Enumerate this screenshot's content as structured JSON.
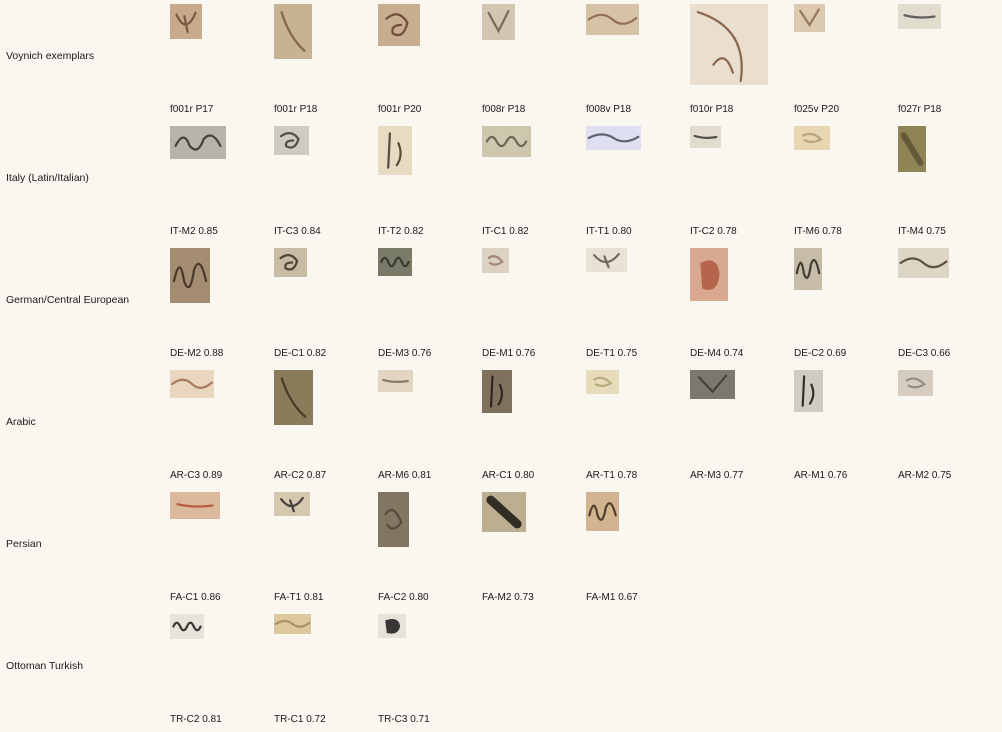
{
  "rows": [
    {
      "label": "Voynich exemplars",
      "items": [
        {
          "caption": "f001r P17",
          "bg": "#c9a98c",
          "ink": "#6b4a34",
          "glyph": "hook"
        },
        {
          "caption": "f001r P18",
          "bg": "#c7b294",
          "ink": "#7a5a3c",
          "glyph": "slash"
        },
        {
          "caption": "f001r P20",
          "bg": "#c8ad90",
          "ink": "#5e3f2a",
          "glyph": "loop"
        },
        {
          "caption": "f008r P18",
          "bg": "#d2c6b0",
          "ink": "#6a5a48",
          "glyph": "vee"
        },
        {
          "caption": "f008v P18",
          "bg": "#d6c2a6",
          "ink": "#8a6448",
          "glyph": "wave"
        },
        {
          "caption": "f010r P18",
          "bg": "#eadfcf",
          "ink": "#7a5436",
          "glyph": "arc"
        },
        {
          "caption": "f025v P20",
          "bg": "#dccab0",
          "ink": "#8a6a4c",
          "glyph": "vee"
        },
        {
          "caption": "f027r P18",
          "bg": "#e2dccf",
          "ink": "#4a4a4a",
          "glyph": "dash"
        }
      ]
    },
    {
      "label": "Italy (Latin/Italian)",
      "items": [
        {
          "caption": "IT-M2 0.85",
          "bg": "#b6b4a8",
          "ink": "#2c2c2c",
          "glyph": "script"
        },
        {
          "caption": "IT-C3 0.84",
          "bg": "#cfcbc2",
          "ink": "#3c3a36",
          "glyph": "loop"
        },
        {
          "caption": "IT-T2 0.82",
          "bg": "#e7dcc2",
          "ink": "#3a3224",
          "glyph": "tall"
        },
        {
          "caption": "IT-C1 0.82",
          "bg": "#cfc6ae",
          "ink": "#5a5644",
          "glyph": "curls"
        },
        {
          "caption": "IT-T1 0.80",
          "bg": "#dedff0",
          "ink": "#4a4e5a",
          "glyph": "wave"
        },
        {
          "caption": "IT-C2 0.78",
          "bg": "#e2dccf",
          "ink": "#3a3632",
          "glyph": "dash"
        },
        {
          "caption": "IT-M6 0.78",
          "bg": "#e6d6b2",
          "ink": "#b09a72",
          "glyph": "smudge"
        },
        {
          "caption": "IT-M4 0.75",
          "bg": "#8e8456",
          "ink": "#5a5434",
          "glyph": "bar"
        }
      ]
    },
    {
      "label": "German/Central European",
      "items": [
        {
          "caption": "DE-M2 0.88",
          "bg": "#a48c72",
          "ink": "#3a2a1e",
          "glyph": "script"
        },
        {
          "caption": "DE-C1 0.82",
          "bg": "#c8bca4",
          "ink": "#3a3024",
          "glyph": "loop"
        },
        {
          "caption": "DE-M3 0.76",
          "bg": "#7a7a68",
          "ink": "#2c2c24",
          "glyph": "curls"
        },
        {
          "caption": "DE-M1 0.76",
          "bg": "#dcd2c4",
          "ink": "#9a7a6a",
          "glyph": "smudge"
        },
        {
          "caption": "DE-T1 0.75",
          "bg": "#e8e2d4",
          "ink": "#5a5448",
          "glyph": "hook"
        },
        {
          "caption": "DE-M4 0.74",
          "bg": "#d8a890",
          "ink": "#b05a40",
          "glyph": "blob"
        },
        {
          "caption": "DE-C2 0.69",
          "bg": "#c6bca8",
          "ink": "#2a2620",
          "glyph": "script"
        },
        {
          "caption": "DE-C3 0.66",
          "bg": "#ddd6c6",
          "ink": "#4a3a2a",
          "glyph": "wave"
        }
      ]
    },
    {
      "label": "Arabic",
      "items": [
        {
          "caption": "AR-C3 0.89",
          "bg": "#ead6be",
          "ink": "#9a6a4a",
          "glyph": "wave"
        },
        {
          "caption": "AR-C2 0.87",
          "bg": "#8a7c5a",
          "ink": "#3a3020",
          "glyph": "slash"
        },
        {
          "caption": "AR-M6 0.81",
          "bg": "#e2d6c2",
          "ink": "#7a6a5a",
          "glyph": "dash"
        },
        {
          "caption": "AR-C1 0.80",
          "bg": "#7e725c",
          "ink": "#1e1a14",
          "glyph": "tall"
        },
        {
          "caption": "AR-T1 0.78",
          "bg": "#e6dcbc",
          "ink": "#b0a070",
          "glyph": "smudge"
        },
        {
          "caption": "AR-M3 0.77",
          "bg": "#7c786e",
          "ink": "#3a3832",
          "glyph": "vee"
        },
        {
          "caption": "AR-M1 0.76",
          "bg": "#d0ccc4",
          "ink": "#141414",
          "glyph": "tall"
        },
        {
          "caption": "AR-M2 0.75",
          "bg": "#d6ccc0",
          "ink": "#8a8078",
          "glyph": "smudge"
        }
      ]
    },
    {
      "label": "Persian",
      "items": [
        {
          "caption": "FA-C1 0.86",
          "bg": "#dcb89c",
          "ink": "#b04a34",
          "glyph": "dash"
        },
        {
          "caption": "FA-T1 0.81",
          "bg": "#d6c8ae",
          "ink": "#2a2a2a",
          "glyph": "hook"
        },
        {
          "caption": "FA-C2 0.80",
          "bg": "#807662",
          "ink": "#4a4438",
          "glyph": "smudge"
        },
        {
          "caption": "FA-M2 0.73",
          "bg": "#bcae8e",
          "ink": "#1a1814",
          "glyph": "bar"
        },
        {
          "caption": "FA-M1 0.67",
          "bg": "#d2b490",
          "ink": "#3a2a1e",
          "glyph": "script"
        }
      ]
    },
    {
      "label": "Ottoman Turkish",
      "items": [
        {
          "caption": "TR-C2 0.81",
          "bg": "#e8e4dc",
          "ink": "#1a1a1a",
          "glyph": "curls"
        },
        {
          "caption": "TR-C1 0.72",
          "bg": "#ddc89e",
          "ink": "#a08a5a",
          "glyph": "wave"
        },
        {
          "caption": "TR-C3 0.71",
          "bg": "#e6e2da",
          "ink": "#1a1a1a",
          "glyph": "blob"
        }
      ]
    }
  ]
}
